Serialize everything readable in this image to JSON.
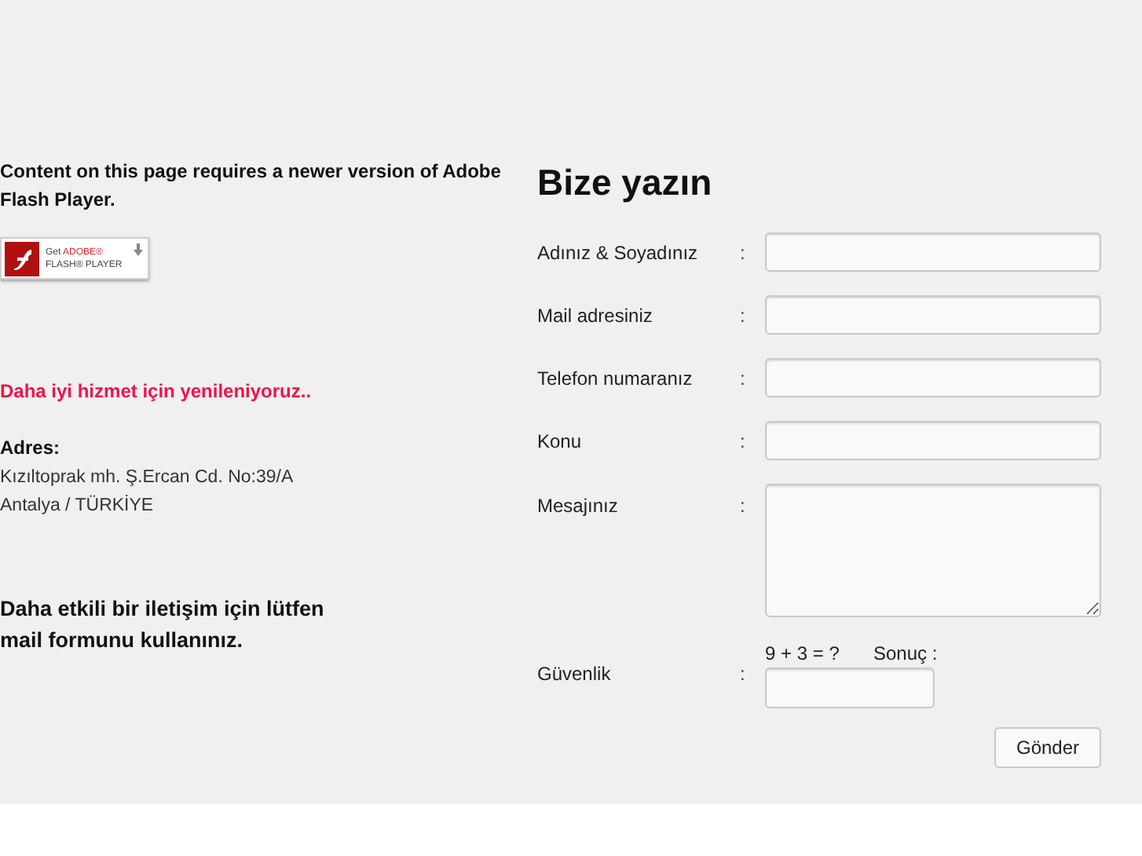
{
  "flash_notice": {
    "message": "Content on this page requires a newer version of Adobe Flash Player.",
    "badge": {
      "line_1_prefix": "Get",
      "line_1_brand": "ADOBE®",
      "line_2": "FLASH® PLAYER"
    }
  },
  "renewal_notice": "Daha iyi hizmet için yenileniyoruz..",
  "address": {
    "heading": "Adres:",
    "lines": [
      "Kızıltoprak mh. Ş.Ercan Cd. No:39/A",
      "Antalya / TÜRKİYE"
    ]
  },
  "contact_hint": [
    "Daha etkili bir iletişim için lütfen",
    "mail formunu kullanınız."
  ],
  "form": {
    "title": "Bize yazın",
    "fields": [
      {
        "kind": "text",
        "label": "Adınız & Soyadınız",
        "separator": ":"
      },
      {
        "kind": "text",
        "label": "Mail adresiniz",
        "separator": ":"
      },
      {
        "kind": "text",
        "label": "Telefon numaranız",
        "separator": ":"
      },
      {
        "kind": "text",
        "label": "Konu",
        "separator": ":"
      },
      {
        "kind": "textarea",
        "label": "Mesajınız",
        "separator": ":"
      },
      {
        "kind": "captcha",
        "label": "Güvenlik",
        "separator": ":",
        "question": "9 + 3 = ?",
        "result_label": "Sonuç :"
      }
    ],
    "submit": "Gönder"
  }
}
